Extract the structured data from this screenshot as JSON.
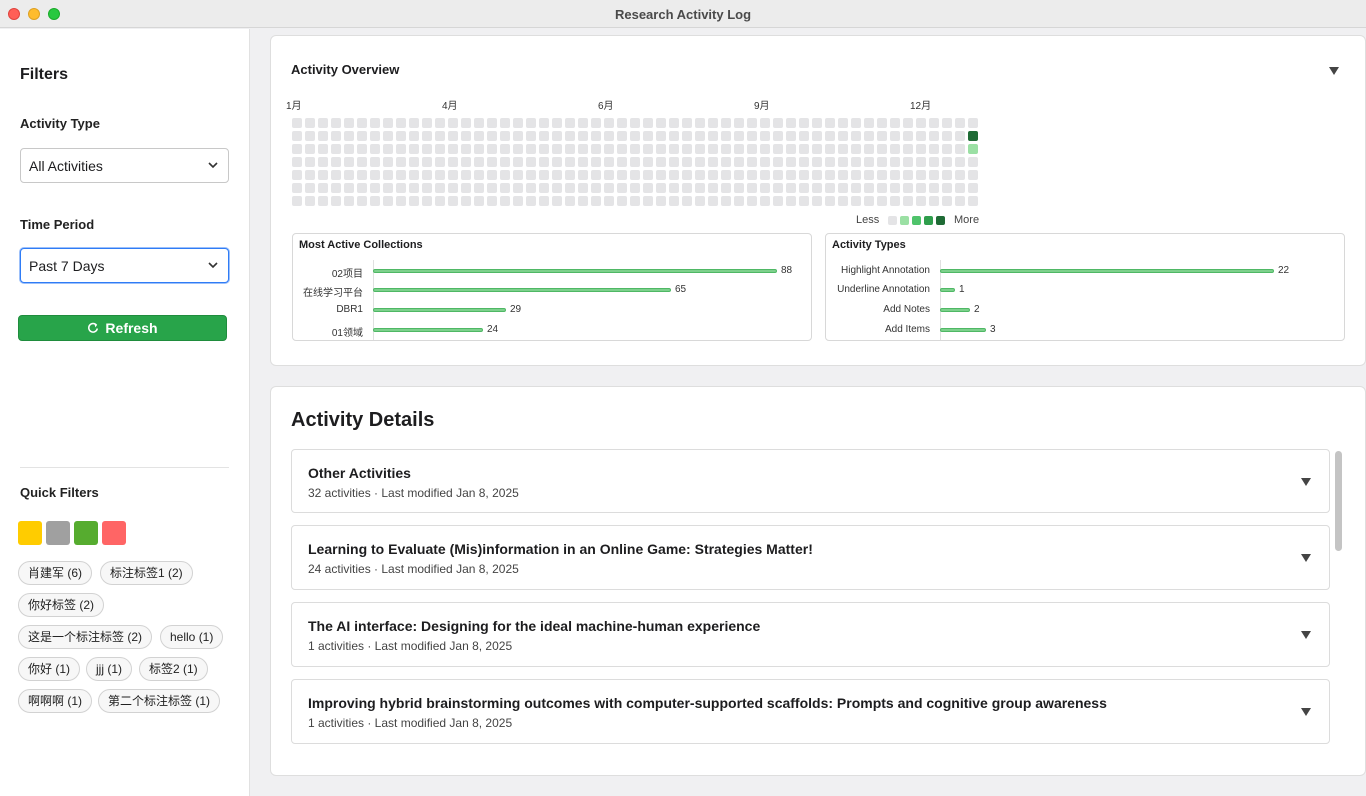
{
  "window": {
    "title": "Research Activity Log"
  },
  "sidebar": {
    "title": "Filters",
    "activity_type": {
      "label": "Activity Type",
      "value": "All Activities"
    },
    "time_period": {
      "label": "Time Period",
      "value": "Past 7 Days"
    },
    "refresh_label": "Refresh",
    "quick_filters": {
      "label": "Quick Filters",
      "colors": [
        "#ffcc00",
        "#a0a0a0",
        "#56ac2f",
        "#ff6565"
      ],
      "tags": [
        "肖建军 (6)",
        "标注标签1 (2)",
        "你好标签 (2)",
        "这是一个标注标签 (2)",
        "hello (1)",
        "你好 (1)",
        "jjj (1)",
        "标签2 (1)",
        "啊啊啊 (1)",
        "第二个标注标签 (1)"
      ]
    }
  },
  "overview": {
    "title": "Activity Overview",
    "months": [
      "1月",
      "4月",
      "6月",
      "9月",
      "12月"
    ],
    "heatmap": {
      "weeks": 53,
      "days": 7,
      "active": [
        {
          "week": 52,
          "day": 1,
          "level": 4
        },
        {
          "week": 52,
          "day": 2,
          "level": 1
        }
      ]
    },
    "legend": {
      "less": "Less",
      "more": "More",
      "levels": [
        "#e4e4e6",
        "#9be0a4",
        "#4fc36b",
        "#2f9e4c",
        "#1f6b35"
      ]
    },
    "collections": {
      "title": "Most Active Collections",
      "items": [
        {
          "label": "02项目",
          "value": 88
        },
        {
          "label": "在线学习平台",
          "value": 65
        },
        {
          "label": "DBR1",
          "value": 29
        },
        {
          "label": "01领域",
          "value": 24
        }
      ]
    },
    "types": {
      "title": "Activity Types",
      "items": [
        {
          "label": "Highlight Annotation",
          "value": 22
        },
        {
          "label": "Underline Annotation",
          "value": 1
        },
        {
          "label": "Add Notes",
          "value": 2
        },
        {
          "label": "Add Items",
          "value": 3
        }
      ]
    }
  },
  "details": {
    "title": "Activity Details",
    "items": [
      {
        "title": "Other Activities",
        "subtitle": "32 activities · Last modified Jan 8, 2025"
      },
      {
        "title": "Learning to Evaluate (Mis)information in an Online Game: Strategies Matter!",
        "subtitle": "24 activities · Last modified Jan 8, 2025"
      },
      {
        "title": "The AI interface: Designing for the ideal machine-human experience",
        "subtitle": "1 activities · Last modified Jan 8, 2025"
      },
      {
        "title": "Improving hybrid brainstorming outcomes with computer-supported scaffolds: Prompts and cognitive group awareness",
        "subtitle": "1 activities · Last modified Jan 8, 2025"
      }
    ]
  }
}
